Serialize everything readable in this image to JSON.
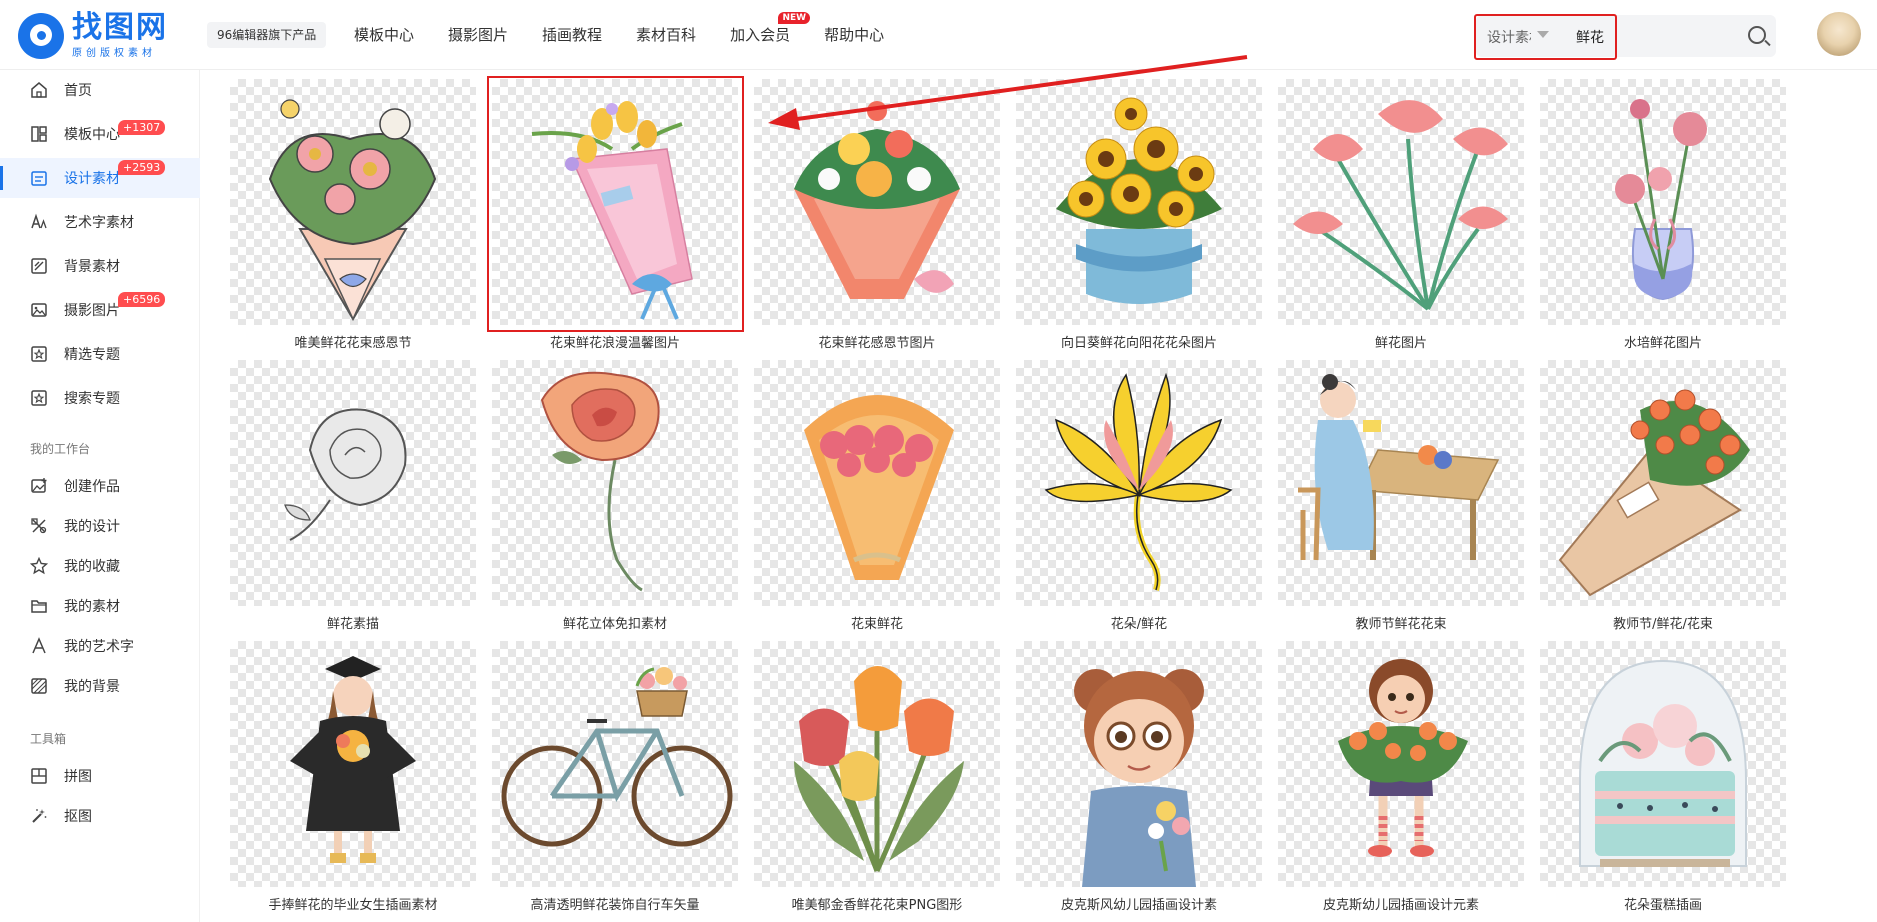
{
  "header": {
    "logo_title": "找图网",
    "logo_sub": "原创版权素材",
    "badge": "96编辑器旗下产品",
    "nav": [
      "模板中心",
      "摄影图片",
      "插画教程",
      "素材百科",
      "加入会员",
      "帮助中心"
    ],
    "nav_new_badge": "NEW",
    "search_type": "设计素材",
    "search_value": "鲜花"
  },
  "sidebar": {
    "items": [
      {
        "label": "首页",
        "icon": "home-icon"
      },
      {
        "label": "模板中心",
        "icon": "template-icon",
        "count": "+1307"
      },
      {
        "label": "设计素材",
        "icon": "design-material-icon",
        "count": "+2593",
        "active": true
      },
      {
        "label": "艺术字素材",
        "icon": "art-font-icon"
      },
      {
        "label": "背景素材",
        "icon": "background-icon"
      },
      {
        "label": "摄影图片",
        "icon": "photo-icon",
        "count": "+6596"
      },
      {
        "label": "精选专题",
        "icon": "featured-topic-icon"
      },
      {
        "label": "搜索专题",
        "icon": "search-topic-icon"
      }
    ],
    "workspace_title": "我的工作台",
    "workspace": [
      {
        "label": "创建作品",
        "icon": "create-icon"
      },
      {
        "label": "我的设计",
        "icon": "my-design-icon"
      },
      {
        "label": "我的收藏",
        "icon": "star-icon"
      },
      {
        "label": "我的素材",
        "icon": "folder-icon"
      },
      {
        "label": "我的艺术字",
        "icon": "letter-a-icon"
      },
      {
        "label": "我的背景",
        "icon": "background-pattern-icon"
      }
    ],
    "tools_title": "工具箱",
    "tools": [
      {
        "label": "拼图",
        "icon": "collage-icon"
      },
      {
        "label": "抠图",
        "icon": "cutout-icon"
      }
    ]
  },
  "cards": [
    "唯美鲜花花束感恩节",
    "花束鲜花浪漫温馨图片",
    "花束鲜花感恩节图片",
    "向日葵鲜花向阳花花朵图片",
    "鲜花图片",
    "水培鲜花图片",
    "鲜花素描",
    "鲜花立体免扣素材",
    "花束鲜花",
    "花朵/鲜花",
    "教师节鲜花花束",
    "教师节/鲜花/花束",
    "手捧鲜花的毕业女生插画素材",
    "高清透明鲜花装饰自行车矢量",
    "唯美郁金香鲜花花束PNG图形",
    "皮克斯风幼儿园插画设计素",
    "皮克斯幼儿园插画设计元素",
    "花朵蛋糕插画"
  ],
  "colors": {
    "brand": "#1a73e8",
    "highlight": "#e02020",
    "count_badge": "#ff4d4f"
  }
}
